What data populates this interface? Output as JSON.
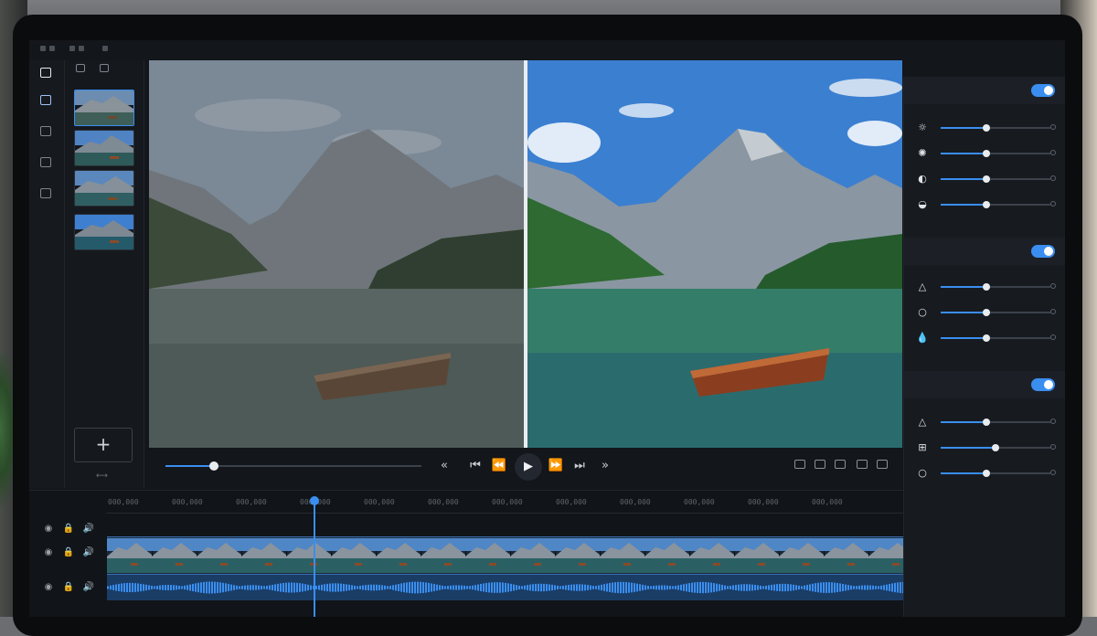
{
  "window": {
    "title": ""
  },
  "icons": {
    "rail": [
      "folder-icon",
      "media-icon",
      "export-icon",
      "effects-icon",
      "layers-icon"
    ],
    "playback": [
      "skip-start-icon",
      "step-back-icon",
      "rewind-icon",
      "play-icon",
      "forward-icon",
      "step-forward-icon",
      "skip-end-icon"
    ],
    "view": [
      "fit-view-icon",
      "compare-view-icon",
      "grid-view-icon",
      "split-view-icon",
      "fullscreen-icon"
    ],
    "section1": [
      "light-icon",
      "brightness-icon",
      "contrast-icon",
      "exposure-icon"
    ],
    "section2": [
      "triangle-icon",
      "circle-icon",
      "drop-icon"
    ],
    "section3": [
      "triangle-icon",
      "crop-grid-icon",
      "circle-icon"
    ],
    "track": [
      "eye-icon",
      "lock-icon",
      "volume-icon"
    ]
  },
  "media": {
    "add_label": "+",
    "thumbnails": 4
  },
  "preview": {
    "progress": 0.19
  },
  "adjustments": {
    "sections": [
      {
        "enabled": true,
        "values": [
          0.42,
          0.42,
          0.42,
          0.42
        ]
      },
      {
        "enabled": true,
        "values": [
          0.42,
          0.42,
          0.42
        ]
      },
      {
        "enabled": true,
        "values": [
          0.42,
          0.5,
          0.42
        ]
      }
    ]
  },
  "timeline": {
    "ruler_labels": [
      "000,000",
      "000,000",
      "000,000",
      "000,000",
      "000,000",
      "000,000",
      "000,000",
      "000,000",
      "000,000",
      "000,000",
      "000,000",
      "000,000"
    ],
    "playhead_fraction": 0.26
  },
  "colors": {
    "accent": "#3a8ef0",
    "panel": "#171b20",
    "background": "#13161a"
  }
}
